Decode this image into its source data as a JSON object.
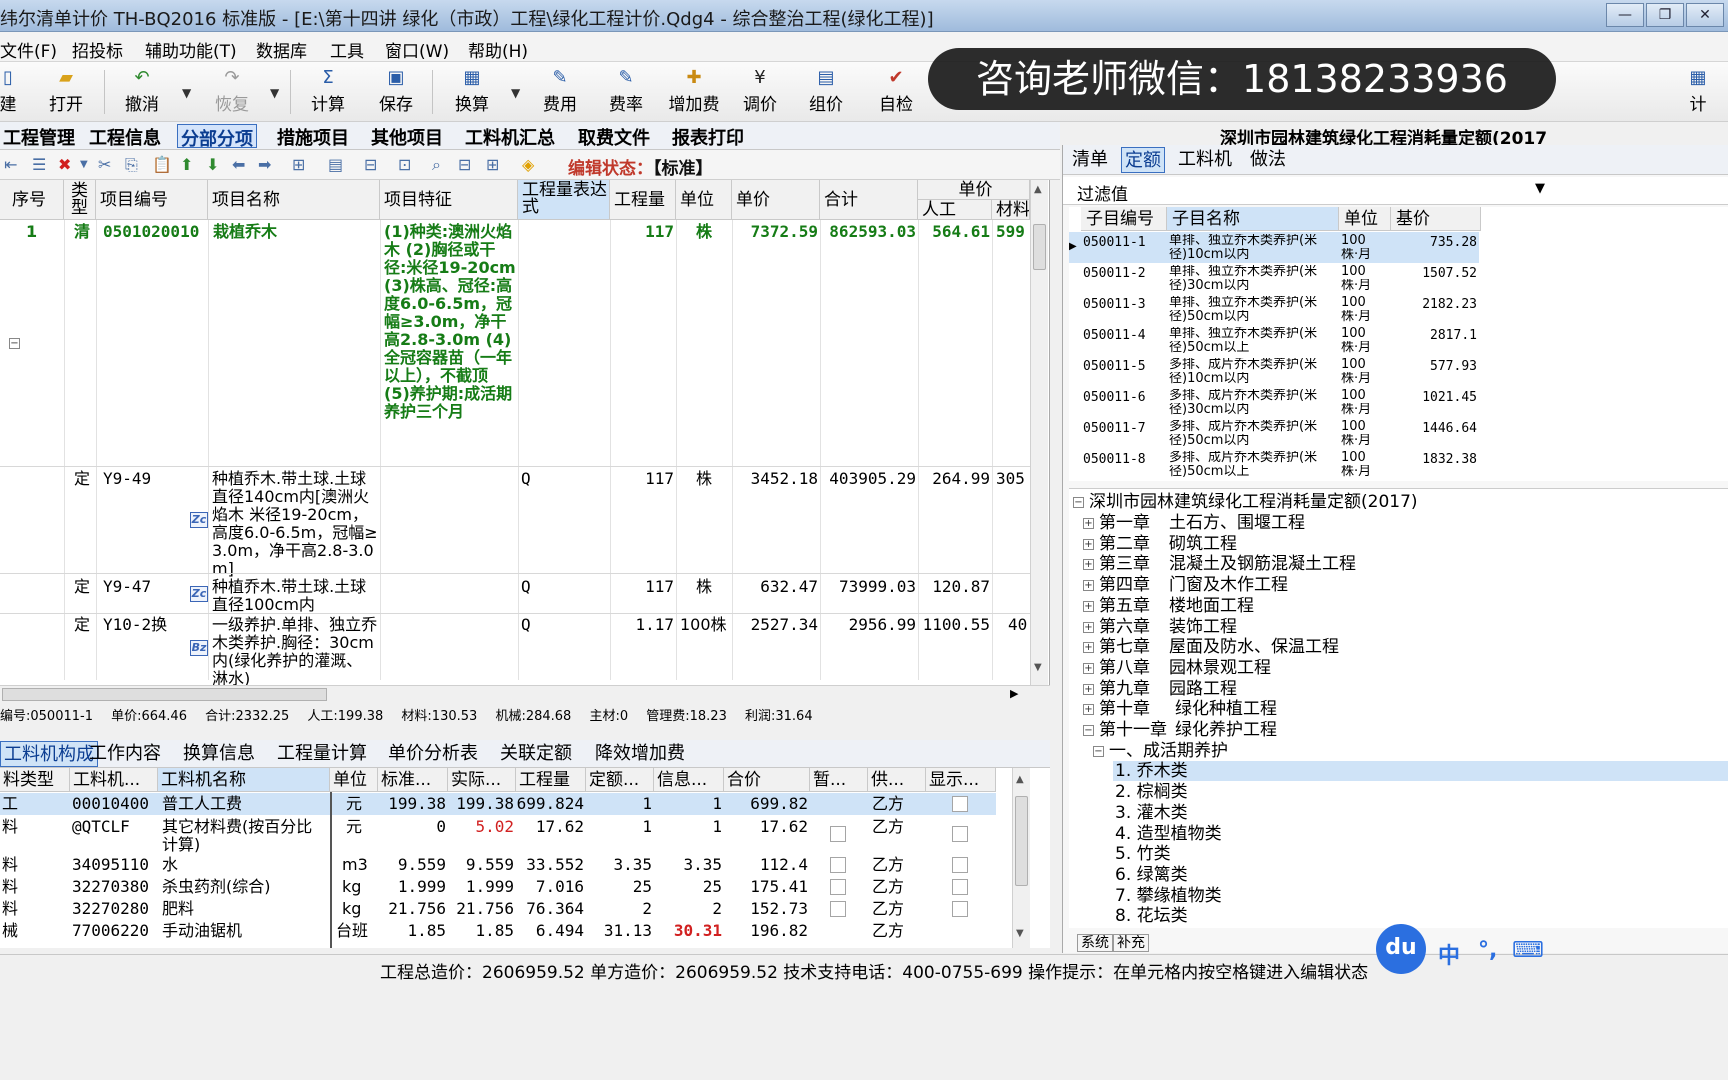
{
  "window": {
    "title": "纬尔清单计价 TH-BQ2016 标准版 - [E:\\第十四讲 绿化（市政）工程\\绿化工程计价.Qdg4 - 综合整治工程(绿化工程)]",
    "min": "—",
    "max": "❐",
    "close": "✕"
  },
  "menu": [
    "文件(F)",
    "招投标",
    "辅助功能(T)",
    "数据库",
    "工具",
    "窗口(W)",
    "帮助(H)"
  ],
  "toolbar": {
    "new": "建",
    "open": "打开",
    "undo": "撤消",
    "redo": "恢复",
    "calc": "计算",
    "save": "保存",
    "convert": "换算",
    "fee": "费用",
    "rate": "费率",
    "addfee": "增加费",
    "adjust": "调价",
    "group": "组价",
    "check": "自检",
    "right_calc": "计"
  },
  "overlay": {
    "wechat": "咨询老师微信：18138233936"
  },
  "module_tabs": [
    "工程管理",
    "工程信息",
    "分部分项",
    "措施项目",
    "其他项目",
    "工料机汇总",
    "取费文件",
    "报表打印"
  ],
  "quota_title": "深圳市园林建筑绿化工程消耗量定额(2017",
  "edit_state": {
    "label": "编辑状态：",
    "value": "【标准】"
  },
  "grid": {
    "headers": {
      "seq": "序号",
      "type": "类型",
      "code": "项目编号",
      "name": "项目名称",
      "feature": "项目特征",
      "expr": "工程量表达式",
      "qty": "工程量",
      "unit": "单位",
      "price": "单价",
      "total": "合计",
      "unitgroup": "单价",
      "labor": "人工",
      "material": "材料"
    },
    "rows": [
      {
        "seq": "1",
        "type": "清",
        "code": "0501020010",
        "name": "栽植乔木",
        "feature": "(1)种类:澳洲火焰木 (2)胸径或干径:米径19-20cm (3)株高、冠径:高度6.0-6.5m，冠幅≥3.0m，净干高2.8-3.0m (4)全冠容器苗（一年以上），不截顶 (5)养护期:成活期养护三个月",
        "expr": "",
        "qty": "117",
        "unit": "株",
        "price": "7372.59",
        "total": "862593.03",
        "labor": "564.61",
        "material": "599"
      },
      {
        "seq": "",
        "type": "定",
        "code": "Y9-49",
        "name": "种植乔木.带土球.土球直径140cm内[澳洲火焰木 米径19-20cm，高度6.0-6.5m，冠幅≥3.0m，净干高2.8-3.0m]",
        "badge": "Zc",
        "expr": "Q",
        "qty": "117",
        "unit": "株",
        "price": "3452.18",
        "total": "403905.29",
        "labor": "264.99",
        "material": "305"
      },
      {
        "seq": "",
        "type": "定",
        "code": "Y9-47",
        "name": "种植乔木.带土球.土球直径100cm内",
        "badge": "Zc",
        "expr": "Q",
        "qty": "117",
        "unit": "株",
        "price": "632.47",
        "total": "73999.03",
        "labor": "120.87",
        "material": ""
      },
      {
        "seq": "",
        "type": "定",
        "code": "Y10-2换",
        "name": "一级养护.单排、独立乔木类养护.胸径：30cm内(绿化养护的灌溉、淋水)",
        "badge": "Bz",
        "expr": "Q",
        "qty": "1.17",
        "unit": "100株",
        "price": "2527.34",
        "total": "2956.99",
        "labor": "1100.55",
        "material": "40"
      }
    ]
  },
  "infoline": [
    "编号:050011-1",
    "单价:664.46",
    "合计:2332.25",
    "人工:199.38",
    "材料:130.53",
    "机械:284.68",
    "主材:0",
    "管理费:18.23",
    "利润:31.64"
  ],
  "bottom_tabs": [
    "工料机构成",
    "工作内容",
    "换算信息",
    "工程量计算",
    "单价分析表",
    "关联定额",
    "降效增加费"
  ],
  "bottom_grid": {
    "headers": [
      "料类型",
      "工料机...",
      "工料机名称",
      "单位",
      "标准...",
      "实际...",
      "工程量",
      "定额...",
      "信息...",
      "合价",
      "暂...",
      "供...",
      "显示..."
    ],
    "rows": [
      [
        "工",
        "00010400",
        "普工人工费",
        "元",
        "199.38",
        "199.38",
        "699.824",
        "1",
        "1",
        "699.82",
        "",
        "乙方"
      ],
      [
        "料",
        "@QTCLF",
        "其它材料费(按百分比计算)",
        "元",
        "0",
        "5.02",
        "17.62",
        "1",
        "1",
        "17.62",
        "",
        "乙方"
      ],
      [
        "料",
        "34095110",
        "水",
        "m3",
        "9.559",
        "9.559",
        "33.552",
        "3.35",
        "3.35",
        "112.4",
        "",
        "乙方"
      ],
      [
        "料",
        "32270380",
        "杀虫药剂(综合)",
        "kg",
        "1.999",
        "1.999",
        "7.016",
        "25",
        "25",
        "175.41",
        "",
        "乙方"
      ],
      [
        "料",
        "32270280",
        "肥料",
        "kg",
        "21.756",
        "21.756",
        "76.364",
        "2",
        "2",
        "152.73",
        "",
        "乙方"
      ],
      [
        "械",
        "77006220",
        "手动油锯机",
        "台班",
        "1.85",
        "1.85",
        "6.494",
        "31.13",
        "30.31",
        "196.82",
        "",
        "乙方"
      ]
    ]
  },
  "status": "工程总造价：2606959.52  单方造价：2606959.52  技术支持电话：400-0755-699  操作提示：在单元格内按空格键进入编辑状态",
  "right": {
    "tabs": [
      "清单",
      "定额",
      "工料机",
      "做法"
    ],
    "filter_label": "过滤值",
    "quota_headers": [
      "子目编号",
      "子目名称",
      "单位",
      "基价"
    ],
    "quotas": [
      {
        "code": "050011-1",
        "name1": "单排、独立乔木类养护(米",
        "name2": "径)10cm以内",
        "unit1": "100",
        "unit2": "株·月",
        "price": "735.28"
      },
      {
        "code": "050011-2",
        "name1": "单排、独立乔木类养护(米",
        "name2": "径)30cm以内",
        "unit1": "100",
        "unit2": "株·月",
        "price": "1507.52"
      },
      {
        "code": "050011-3",
        "name1": "单排、独立乔木类养护(米",
        "name2": "径)50cm以内",
        "unit1": "100",
        "unit2": "株·月",
        "price": "2182.23"
      },
      {
        "code": "050011-4",
        "name1": "单排、独立乔木类养护(米",
        "name2": "径)50cm以上",
        "unit1": "100",
        "unit2": "株·月",
        "price": "2817.1"
      },
      {
        "code": "050011-5",
        "name1": "多排、成片乔木类养护(米",
        "name2": "径)10cm以内",
        "unit1": "100",
        "unit2": "株·月",
        "price": "577.93"
      },
      {
        "code": "050011-6",
        "name1": "多排、成片乔木类养护(米",
        "name2": "径)30cm以内",
        "unit1": "100",
        "unit2": "株·月",
        "price": "1021.45"
      },
      {
        "code": "050011-7",
        "name1": "多排、成片乔木类养护(米",
        "name2": "径)50cm以内",
        "unit1": "100",
        "unit2": "株·月",
        "price": "1446.64"
      },
      {
        "code": "050011-8",
        "name1": "多排、成片乔木类养护(米",
        "name2": "径)50cm以上",
        "unit1": "100",
        "unit2": "株·月",
        "price": "1832.38"
      }
    ],
    "tree_root": "深圳市园林建筑绿化工程消耗量定额(2017)",
    "chapters": [
      [
        "第一章",
        "土石方、围堰工程"
      ],
      [
        "第二章",
        "砌筑工程"
      ],
      [
        "第三章",
        "混凝土及钢筋混凝土工程"
      ],
      [
        "第四章",
        "门窗及木作工程"
      ],
      [
        "第五章",
        "楼地面工程"
      ],
      [
        "第六章",
        "装饰工程"
      ],
      [
        "第七章",
        "屋面及防水、保温工程"
      ],
      [
        "第八章",
        "园林景观工程"
      ],
      [
        "第九章",
        "园路工程"
      ],
      [
        "第十章",
        "绿化种植工程"
      ],
      [
        "第十一章",
        "绿化养护工程"
      ]
    ],
    "section": "一、成活期养护",
    "leaves": [
      "1. 乔木类",
      "2. 棕榈类",
      "3. 灌木类",
      "4. 造型植物类",
      "5. 竹类",
      "6. 绿篱类",
      "7. 攀缘植物类",
      "8. 花坛类"
    ],
    "bottom_tabs": [
      "系统",
      "补充"
    ]
  },
  "ime": {
    "du": "du",
    "zh": "中",
    "dot": "°,",
    "kb": "⌨"
  }
}
